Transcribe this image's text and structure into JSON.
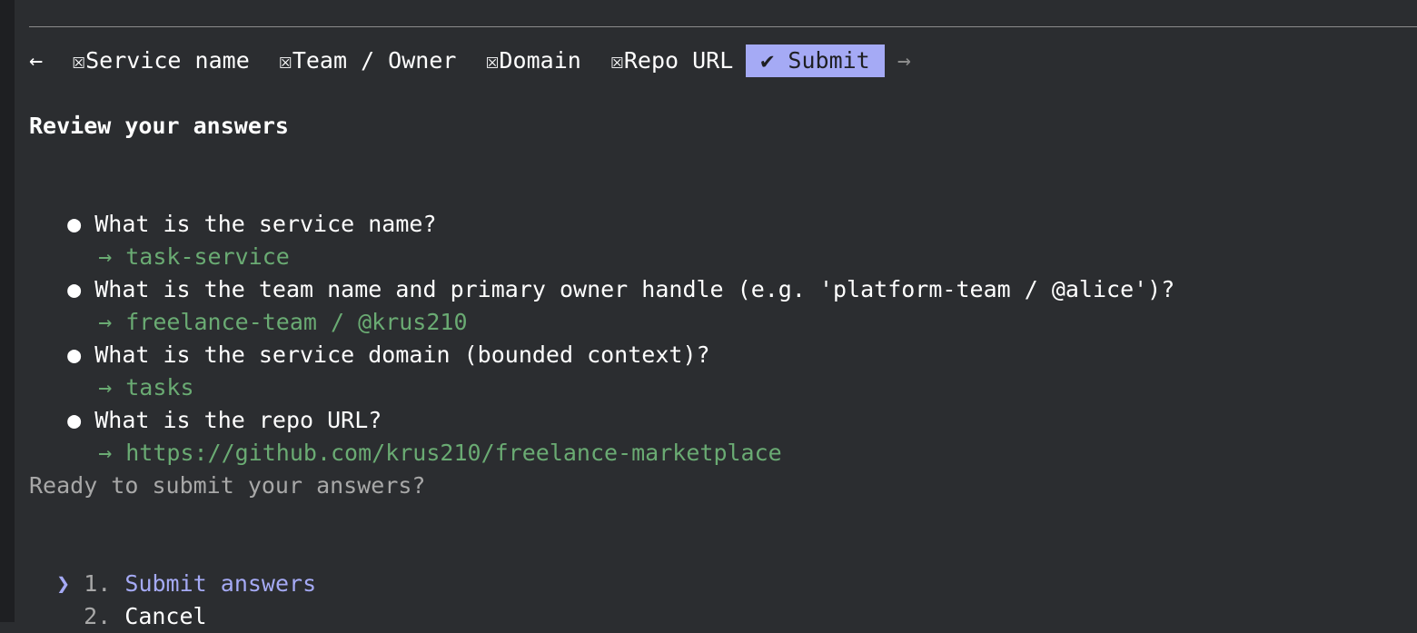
{
  "tabs": {
    "back_arrow": "←",
    "forward_arrow": "→",
    "items": [
      {
        "icon": "☒",
        "label": "Service name"
      },
      {
        "icon": "☒",
        "label": "Team / Owner"
      },
      {
        "icon": "☒",
        "label": "Domain"
      },
      {
        "icon": "☒",
        "label": "Repo URL"
      }
    ],
    "active": {
      "icon": "✔",
      "label": "Submit"
    }
  },
  "review": {
    "title": "Review your answers",
    "bullet": "●",
    "answer_arrow": "→",
    "items": [
      {
        "question": "What is the service name?",
        "answer": "task-service"
      },
      {
        "question": "What is the team name and primary owner handle (e.g. 'platform-team / @alice')?",
        "answer": "freelance-team / @krus210"
      },
      {
        "question": "What is the service domain (bounded context)?",
        "answer": "tasks"
      },
      {
        "question": "What is the repo URL?",
        "answer": "https://github.com/krus210/freelance-marketplace"
      }
    ]
  },
  "prompt": "Ready to submit your answers?",
  "options": {
    "cursor": "❯",
    "items": [
      {
        "number": "1.",
        "label": "Submit answers"
      },
      {
        "number": "2.",
        "label": "Cancel"
      }
    ]
  },
  "colors": {
    "background": "#2b2d30",
    "active_tab": "#a5aaf5",
    "answer_green": "#6aab73",
    "selected_purple": "#a5aaf5"
  }
}
